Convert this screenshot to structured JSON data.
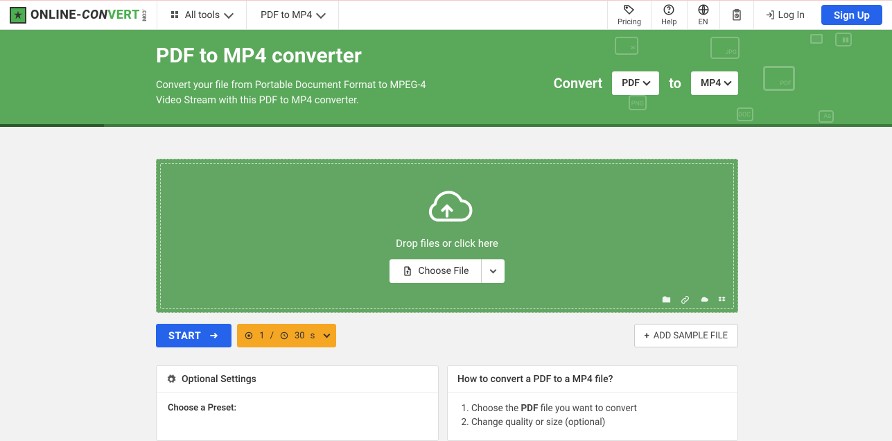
{
  "nav": {
    "brand_part1": "ONLINE-",
    "brand_part2": "CON",
    "brand_part3": "VERT",
    "brand_suffix": ".COM",
    "all_tools": "All tools",
    "current_tool": "PDF to MP4",
    "pricing": "Pricing",
    "help": "Help",
    "lang": "EN",
    "login": "Log In",
    "signup": "Sign Up"
  },
  "hero": {
    "title": "PDF to MP4 converter",
    "desc": "Convert your file from Portable Document Format to MPEG-4 Video Stream with this PDF to MP4 converter.",
    "convert_label": "Convert",
    "from": "PDF",
    "to_label": "to",
    "to": "MP4"
  },
  "drop": {
    "label": "Drop files or click here",
    "choose": "Choose File"
  },
  "actions": {
    "start": "START",
    "file_count": "1",
    "sep": "/",
    "duration_num": "30",
    "duration_unit": "s",
    "add_sample": "ADD SAMPLE FILE"
  },
  "settings": {
    "heading": "Optional Settings",
    "preset_label": "Choose a Preset:"
  },
  "howto": {
    "heading": "How to convert a PDF to a MP4 file?",
    "step1_a": "Choose the ",
    "step1_b": "PDF",
    "step1_c": " file you want to convert",
    "step2": "Change quality or size (optional)"
  }
}
